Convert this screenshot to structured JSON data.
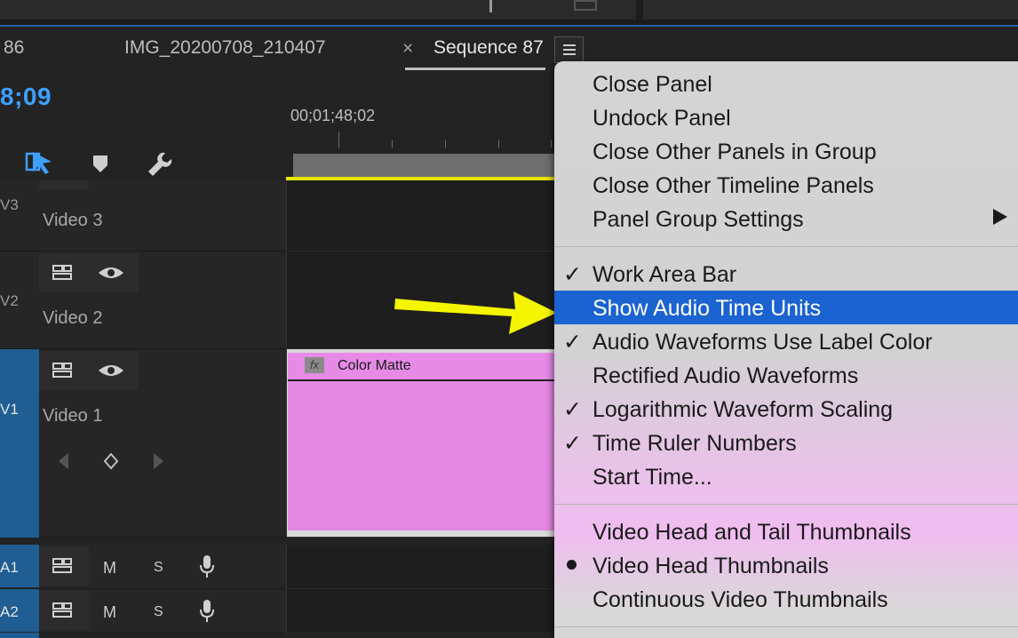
{
  "tabs": {
    "partial_tab": "86",
    "tab_img": "IMG_20200708_210407",
    "close_glyph": "×",
    "tab_sequence": "Sequence 87",
    "menu_icon": "hamburger-icon"
  },
  "timeline": {
    "timecode": "8;09",
    "ruler_time": "00;01;48;02",
    "tools": [
      "snap-icon",
      "marker-icon",
      "wrench-icon"
    ]
  },
  "tracks": [
    {
      "id": "V3",
      "name": "Video 3"
    },
    {
      "id": "V2",
      "name": "Video 2"
    },
    {
      "id": "V1",
      "name": "Video 1"
    },
    {
      "id": "A1",
      "mute": "M",
      "solo": "S"
    },
    {
      "id": "A2",
      "mute": "M",
      "solo": "S"
    }
  ],
  "clip": {
    "fx": "fx",
    "name": "Color Matte",
    "color": "#e387e3"
  },
  "menu": {
    "group1": [
      {
        "label": "Close Panel"
      },
      {
        "label": "Undock Panel"
      },
      {
        "label": "Close Other Panels in Group"
      },
      {
        "label": "Close Other Timeline Panels"
      },
      {
        "label": "Panel Group Settings",
        "submenu": true
      }
    ],
    "group2": [
      {
        "label": "Work Area Bar",
        "checked": true
      },
      {
        "label": "Show Audio Time Units",
        "highlighted": true
      },
      {
        "label": "Audio Waveforms Use Label Color",
        "checked": true
      },
      {
        "label": "Rectified Audio Waveforms"
      },
      {
        "label": "Logarithmic Waveform Scaling",
        "checked": true
      },
      {
        "label": "Time Ruler Numbers",
        "checked": true
      },
      {
        "label": "Start Time..."
      }
    ],
    "group3": [
      {
        "label": "Video Head and Tail Thumbnails"
      },
      {
        "label": "Video Head Thumbnails",
        "selected": true
      },
      {
        "label": "Continuous Video Thumbnails"
      }
    ],
    "check_glyph": "✓",
    "highlight_color": "#1a63d1"
  },
  "annotation": {
    "arrow_color": "#f5f500"
  }
}
